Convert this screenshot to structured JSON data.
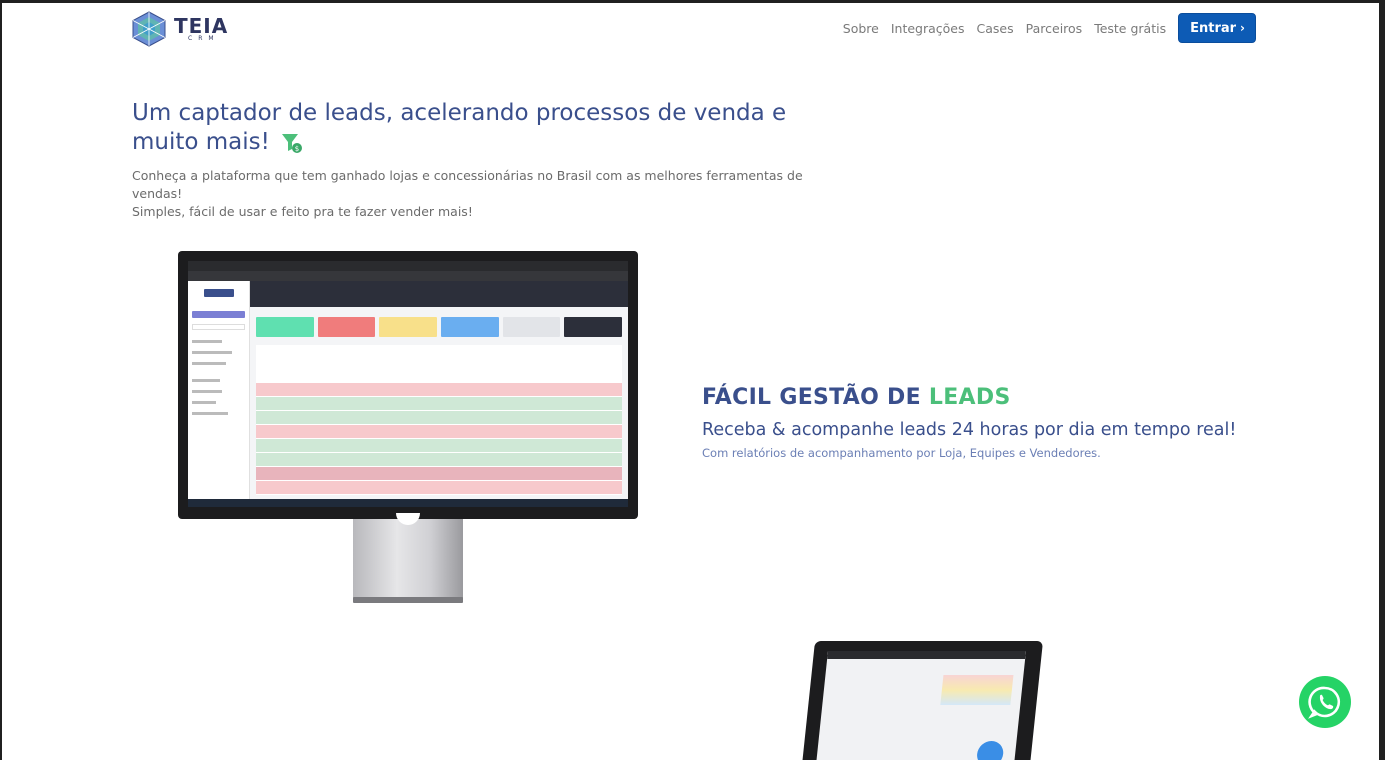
{
  "logo": {
    "name": "TEIA",
    "sub": "CRM"
  },
  "nav": {
    "links": [
      "Sobre",
      "Integrações",
      "Cases",
      "Parceiros",
      "Teste grátis"
    ],
    "cta": "Entrar"
  },
  "hero": {
    "title": "Um captador de leads, acelerando processos de venda e muito mais!",
    "description_line1": "Conheça a plataforma que tem ganhado lojas e concessionárias no Brasil com as melhores ferramentas de vendas!",
    "description_line2": "Simples, fácil de usar e feito pra te fazer vender mais!"
  },
  "feature": {
    "title_prefix": "FÁCIL GESTÃO DE ",
    "title_accent": "LEADS",
    "subtitle": "Receba & acompanhe leads 24 horas por dia em tempo real!",
    "note": "Com relatórios de acompanhamento por Loja, Equipes e Vendedores."
  },
  "colors": {
    "brand": "#3a4f8c",
    "accent_green": "#4cbf7a",
    "cta_blue": "#0d5bb5",
    "whatsapp": "#25d366"
  },
  "icons": [
    "teia-logo-icon",
    "funnel-money-icon",
    "chevron-right-icon",
    "whatsapp-icon"
  ]
}
